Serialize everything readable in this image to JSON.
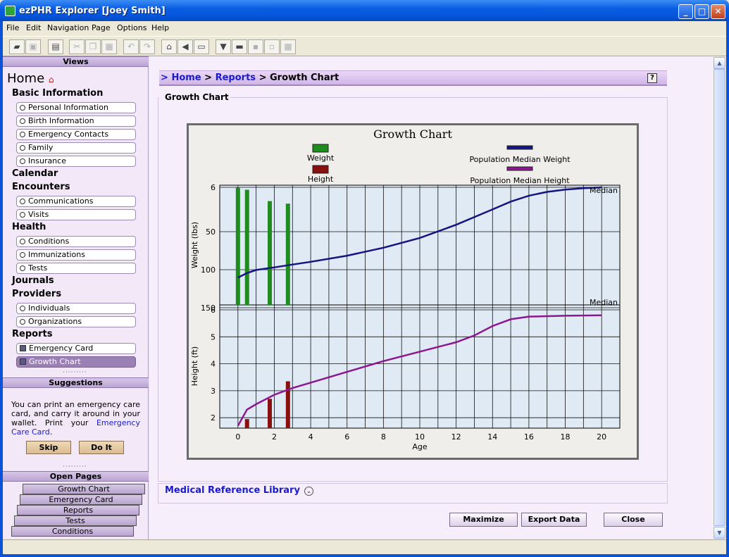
{
  "window": {
    "title": "ezPHR Explorer [Joey Smith]"
  },
  "menu": [
    "File",
    "Edit",
    "Navigation",
    "Page",
    "Options",
    "Help"
  ],
  "sidebar": {
    "views_label": "Views",
    "home_label": "Home",
    "categories": {
      "basic": "Basic Information",
      "calendar": "Calendar",
      "encounters": "Encounters",
      "health": "Health",
      "journals": "Journals",
      "providers": "Providers",
      "reports": "Reports"
    },
    "basic_items": [
      "Personal Information",
      "Birth Information",
      "Emergency Contacts",
      "Family",
      "Insurance"
    ],
    "encounter_items": [
      "Communications",
      "Visits"
    ],
    "health_items": [
      "Conditions",
      "Immunizations",
      "Tests"
    ],
    "provider_items": [
      "Individuals",
      "Organizations"
    ],
    "report_items": [
      "Emergency Card",
      "Growth Chart"
    ],
    "suggestions_label": "Suggestions",
    "suggestion_text": "You can print an emergency care card, and carry it around in your wallet. Print your",
    "suggestion_link": "Emergency Care Card",
    "suggestion_end": ".",
    "skip_label": "Skip",
    "doit_label": "Do It",
    "open_pages_label": "Open Pages",
    "open_pages": [
      "Growth Chart",
      "Emergency Card",
      "Reports",
      "Tests",
      "Conditions"
    ]
  },
  "breadcrumb": {
    "prefix": ">",
    "home": "Home",
    "sep1": ">",
    "reports": "Reports",
    "sep2": ">",
    "current": "Growth Chart"
  },
  "panel_title": "Growth Chart",
  "medical_library_label": "Medical Reference Library",
  "buttons": {
    "maximize": "Maximize",
    "export": "Export Data",
    "close": "Close"
  },
  "colors": {
    "weight": "#1e8c1e",
    "height": "#8a1010",
    "median_weight": "#151580",
    "median_height": "#8c1890"
  },
  "chart_data": {
    "type": "bar+line",
    "title": "Growth Chart",
    "legend": [
      "Weight",
      "Height",
      "Population Median Weight",
      "Population Median Height"
    ],
    "xlabel": "Age",
    "xlim": [
      -1,
      21
    ],
    "xticks": [
      0,
      2,
      4,
      6,
      8,
      10,
      12,
      14,
      16,
      18,
      20
    ],
    "weight_panel": {
      "ylabel": "Weight (lbs)",
      "yticks": [
        6,
        50,
        100,
        150
      ],
      "median_label": "Median",
      "bars": {
        "x": [
          0,
          0.5,
          1.75,
          2.75
        ],
        "values": [
          6.5,
          8.4,
          19.7,
          22.2
        ]
      },
      "median": {
        "x": [
          0,
          0.5,
          1,
          2,
          3,
          4,
          6,
          8,
          10,
          12,
          14,
          15,
          16,
          17,
          18,
          19,
          20
        ],
        "values": [
          16.9,
          19.5,
          21.3,
          22.8,
          24.4,
          26.0,
          29.5,
          34.1,
          39.7,
          47.3,
          56.1,
          60.6,
          64.0,
          66.2,
          67.5,
          68.3,
          68.8
        ]
      }
    },
    "height_panel": {
      "ylabel": "Height (ft)",
      "yticks": [
        2,
        3,
        4,
        5,
        6
      ],
      "median_label": "Median",
      "bars": {
        "x": [
          0,
          0.5,
          1.75,
          2.75
        ],
        "values": [
          1.6,
          1.95,
          2.7,
          3.35
        ]
      },
      "median": {
        "x": [
          0,
          0.5,
          1,
          2,
          3,
          4,
          6,
          8,
          10,
          12,
          13,
          14,
          15,
          16,
          18,
          20
        ],
        "values": [
          1.7,
          2.3,
          2.5,
          2.85,
          3.1,
          3.3,
          3.7,
          4.1,
          4.45,
          4.8,
          5.05,
          5.4,
          5.65,
          5.75,
          5.78,
          5.8
        ]
      }
    }
  }
}
